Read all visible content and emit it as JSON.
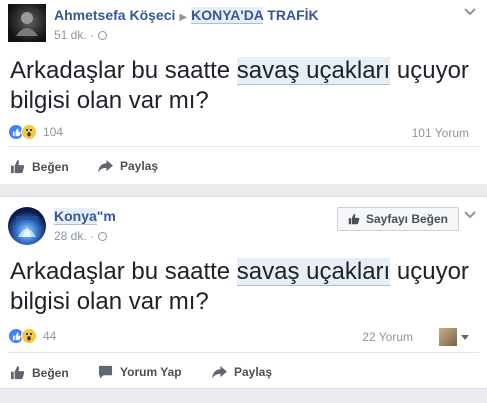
{
  "post1": {
    "author": "Ahmetsefa Köşeci",
    "group_highlight": "KONYA'DA",
    "group_rest": " TRAFİK",
    "time": "51 dk. ·",
    "text": {
      "before": "Arkadaşlar bu saatte ",
      "highlight": "savaş uçakları",
      "after": " uçuyor",
      "line2": "bilgisi olan var mı?"
    },
    "reaction_count": "104",
    "comment_count": "101 Yorum",
    "actions": {
      "like": "Beğen",
      "share": "Paylaş"
    }
  },
  "post2": {
    "author_highlight": "Konya",
    "author_rest": "\"m",
    "time": "28 dk. ·",
    "page_like_button": "Sayfayı Beğen",
    "text": {
      "before": "Arkadaşlar bu saatte ",
      "highlight": "savaş uçakları",
      "after": " uçuyor",
      "line2": "bilgisi olan var mı?"
    },
    "reaction_count": "44",
    "comment_count": "22 Yorum",
    "actions": {
      "like": "Beğen",
      "comment": "Yorum Yap",
      "share": "Paylaş"
    }
  },
  "colors": {
    "link": "#365899",
    "meta": "#90949c",
    "like_blue": "#4080ff",
    "wow_yellow": "#f7c83c",
    "highlight_bg": "#e7eef8"
  },
  "icons": [
    "chevron-down-icon",
    "globe-icon",
    "like-reaction-icon",
    "wow-reaction-icon",
    "thumb-up-icon",
    "share-arrow-icon",
    "comment-icon",
    "thumb-up-small-icon"
  ]
}
